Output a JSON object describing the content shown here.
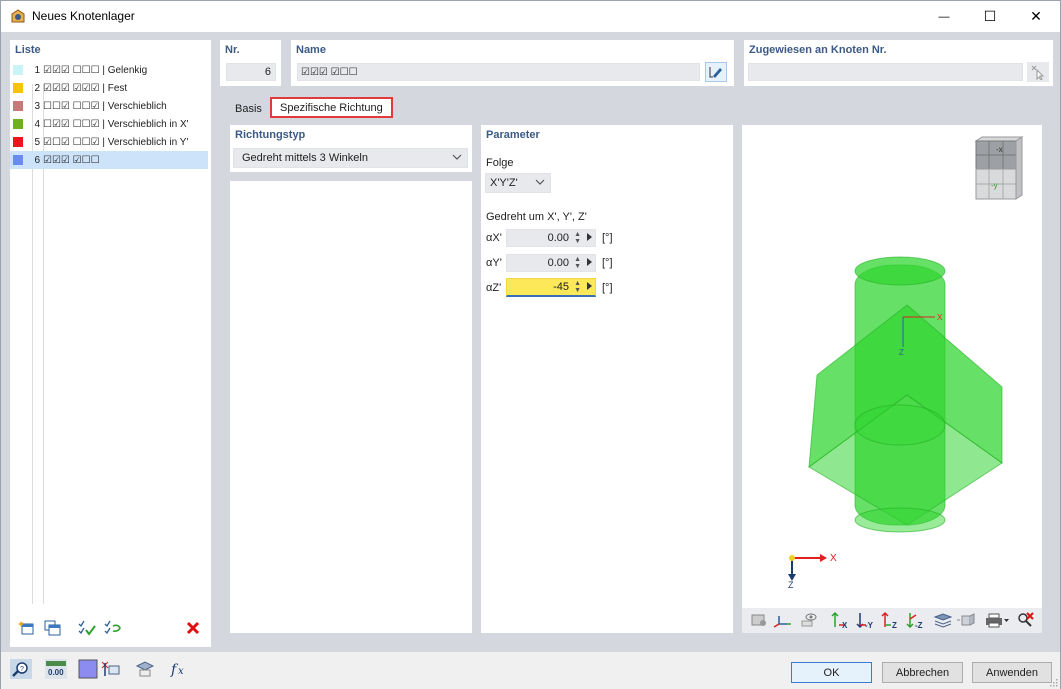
{
  "window": {
    "title": "Neues Knotenlager",
    "minimize_glyph": "—",
    "maximize_glyph": "☐",
    "close_glyph": "✕"
  },
  "list": {
    "title": "Liste",
    "items": [
      {
        "num": "1",
        "flags": "☑☑☑ ☐☐☐ | Gelenkig",
        "color": "#c8f4f8"
      },
      {
        "num": "2",
        "flags": "☑☑☑ ☑☑☑ | Fest",
        "color": "#f6c400"
      },
      {
        "num": "3",
        "flags": "☐☐☑ ☐☐☑ | Verschieblich",
        "color": "#c87a78"
      },
      {
        "num": "4",
        "flags": "☐☑☑ ☐☐☑ | Verschieblich in X'",
        "color": "#6fb01d"
      },
      {
        "num": "5",
        "flags": "☑☐☑ ☐☐☑ | Verschieblich in Y'",
        "color": "#f0141e"
      },
      {
        "num": "6",
        "flags": "☑☑☑ ☑☐☐",
        "color": "#6a8cf0"
      }
    ]
  },
  "nr": {
    "label": "Nr.",
    "value": "6"
  },
  "name": {
    "label": "Name",
    "value": "☑☑☑ ☑☐☐"
  },
  "assigned": {
    "label": "Zugewiesen an Knoten Nr.",
    "value": ""
  },
  "tabs": [
    {
      "label": "Basis"
    },
    {
      "label": "Spezifische Richtung"
    }
  ],
  "richtungstyp": {
    "label": "Richtungstyp",
    "value": "Gedreht mittels 3 Winkeln"
  },
  "parameter": {
    "label": "Parameter",
    "folge_label": "Folge",
    "folge_value": "X'Y'Z'",
    "rotated_label": "Gedreht um X', Y', Z'",
    "rows": [
      {
        "label": "αX'",
        "value": "0.00",
        "unit": "[°]"
      },
      {
        "label": "αY'",
        "value": "0.00",
        "unit": "[°]"
      },
      {
        "label": "αZ'",
        "value": "-45",
        "unit": "[°]"
      }
    ]
  },
  "view": {
    "cube_face_top": "-x",
    "cube_face_front": "-y",
    "axis_x": "X",
    "axis_z": "Z",
    "small_axis_x": "X",
    "small_axis_z": "Z",
    "toolbar_labels": [
      "X",
      "-Y",
      "Z",
      "-Z"
    ],
    "accent_green": "#33d633"
  },
  "footer": {
    "ok": "OK",
    "cancel": "Abbrechen",
    "apply": "Anwenden",
    "units_icon_text": "0.00"
  }
}
